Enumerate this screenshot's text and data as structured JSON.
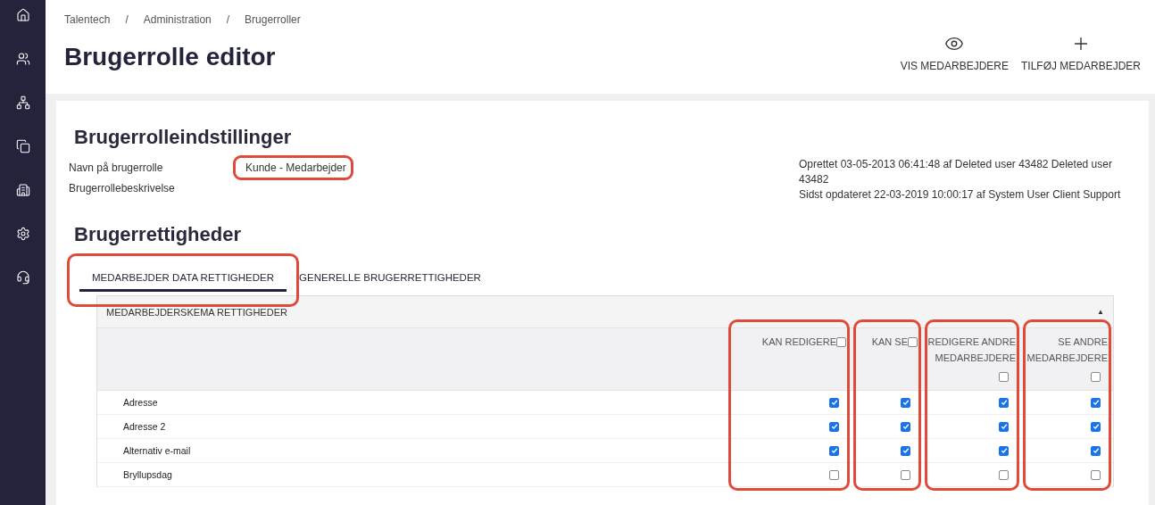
{
  "breadcrumb": {
    "separator": "/",
    "items": [
      "Talentech",
      "Administration",
      "Brugerroller"
    ]
  },
  "title": "Brugerrolle editor",
  "actions": [
    {
      "kind": "view",
      "label": "VIS MEDARBEJDERE"
    },
    {
      "kind": "add",
      "label": "TILFØJ MEDARBEJDER"
    }
  ],
  "settings": {
    "heading": "Brugerrolleindstillinger",
    "fields": [
      {
        "label": "Navn på brugerrolle",
        "value": "Kunde - Medarbejder",
        "highlighted": true
      },
      {
        "label": "Brugerrollebeskrivelse"
      }
    ],
    "meta": [
      "Oprettet 03-05-2013 06:41:48 af Deleted user 43482 Deleted user 43482",
      "Sidst opdateret 22-03-2019 10:00:17 af System User Client Support"
    ]
  },
  "rights": {
    "heading": "Brugerrettigheder",
    "tabs": [
      {
        "label": "MEDARBEJDER DATA RETTIGHEDER",
        "selected": true,
        "highlighted": true
      },
      {
        "label": "GENERELLE BRUGERRETTIGHEDER",
        "selected": false,
        "highlighted": false
      }
    ],
    "table": {
      "title": "MEDARBEJDERSKEMA RETTIGHEDER",
      "collapse_glyph": "▲",
      "columns": [
        {
          "label": "KAN REDIGERE",
          "kind": "inline",
          "checked": false,
          "highlighted": true
        },
        {
          "label": "KAN SE",
          "kind": "inline",
          "checked": false,
          "highlighted": true
        },
        {
          "label": "REDIGERE ANDRE MEDARBEJDERE",
          "kind": "stacked",
          "checked": false,
          "highlighted": true
        },
        {
          "label": "SE ANDRE MEDARBEJDERE",
          "kind": "stacked",
          "checked": false,
          "highlighted": true
        }
      ],
      "rows": [
        {
          "label": "Adresse",
          "values": [
            true,
            true,
            true,
            true
          ]
        },
        {
          "label": "Adresse 2",
          "values": [
            true,
            true,
            true,
            true
          ]
        },
        {
          "label": "Alternativ e-mail",
          "values": [
            true,
            true,
            true,
            true
          ]
        },
        {
          "label": "Bryllupsdag",
          "values": [
            false,
            false,
            false,
            false
          ]
        }
      ]
    }
  }
}
